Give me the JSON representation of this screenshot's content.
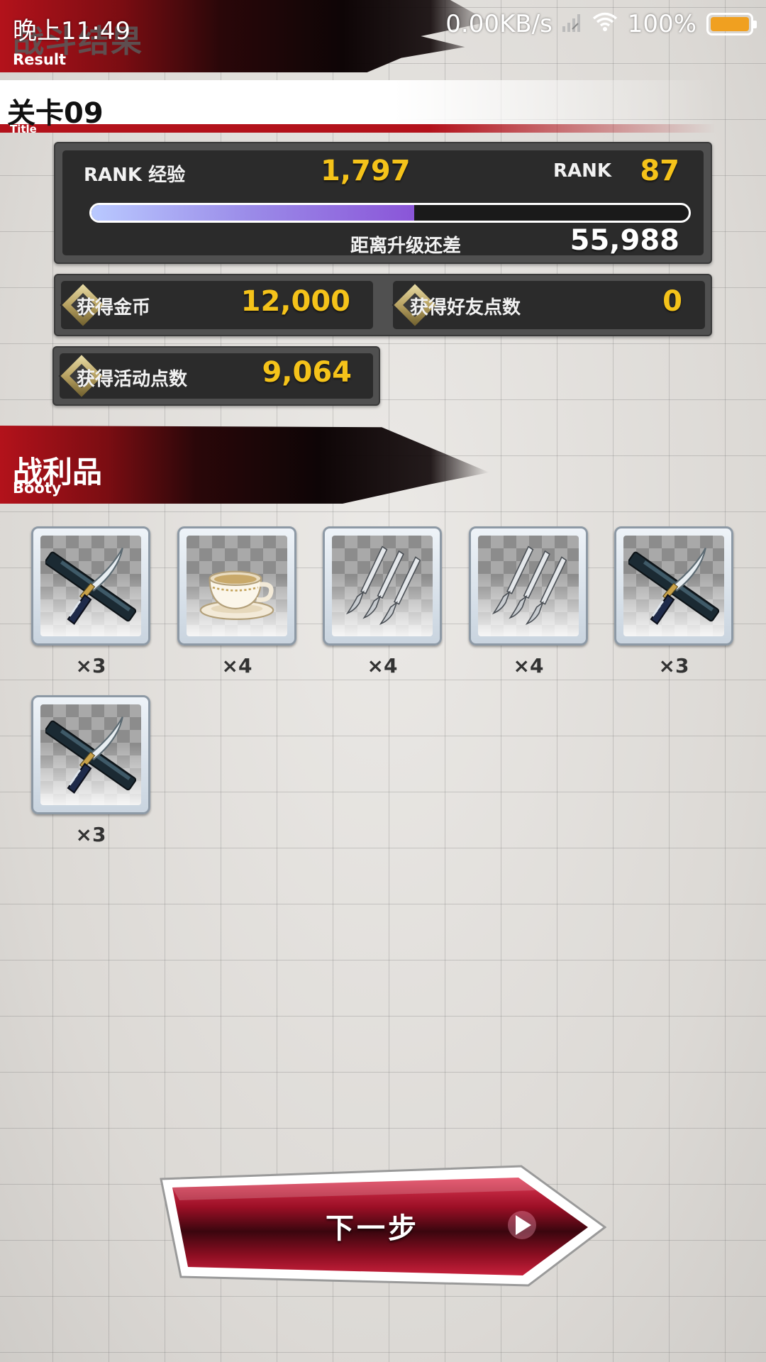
{
  "status_bar": {
    "time": "晚上11:49",
    "network_speed": "0.00KB/s",
    "battery": "100%",
    "battery_level": 1.0,
    "battery_color": "#f0a020"
  },
  "header": {
    "title": "战斗结果",
    "subtitle": "Result"
  },
  "stage": {
    "title": "关卡09",
    "subtitle": "Title"
  },
  "rank": {
    "exp_label": "RANK 经验",
    "exp_value": "1,797",
    "rank_label": "RANK",
    "rank_value": "87",
    "exp_progress": 0.54,
    "remaining_label": "距离升级还差",
    "remaining_value": "55,988"
  },
  "stats": {
    "gold_label": "获得金币",
    "gold_value": "12,000",
    "friend_label": "获得好友点数",
    "friend_value": "0",
    "event_label": "获得活动点数",
    "event_value": "9,064"
  },
  "booty": {
    "title": "战利品",
    "subtitle": "Booty",
    "items": [
      {
        "icon": "crossed-swords-icon",
        "count": "×3"
      },
      {
        "icon": "teacup-icon",
        "count": "×4"
      },
      {
        "icon": "scalpels-icon",
        "count": "×4"
      },
      {
        "icon": "scalpels-icon",
        "count": "×4"
      },
      {
        "icon": "crossed-swords-icon",
        "count": "×3"
      },
      {
        "icon": "crossed-swords-icon",
        "count": "×3"
      }
    ]
  },
  "next_button": {
    "label": "下一步",
    "icon": "play-arrow-icon"
  },
  "colors": {
    "accent_red": "#b3121b",
    "gold_text": "#f5c31a",
    "panel_dark": "#2b2b2b"
  }
}
